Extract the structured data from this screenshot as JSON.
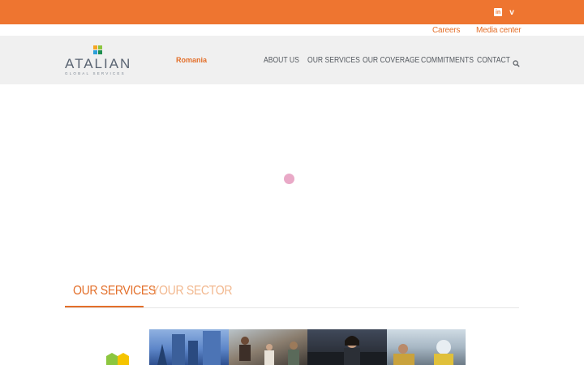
{
  "topbar": {
    "color": "#ee7530",
    "social": [
      {
        "icon": "linkedin-icon",
        "glyph": "in"
      },
      {
        "icon": "vimeo-icon",
        "glyph": "v"
      }
    ]
  },
  "utility_links": {
    "careers": "Careers",
    "media_center": "Media center"
  },
  "header": {
    "logo": {
      "name": "ATALIAN",
      "tagline": "GLOBAL SERVICES"
    },
    "country": "Romania",
    "nav": {
      "about": "ABOUT US",
      "services": "OUR SERVICES",
      "coverage": "OUR COVERAGE",
      "commitments": "COMMITMENTS",
      "contact": "CONTACT"
    },
    "search_icon": "search-icon"
  },
  "loader": {
    "color": "#e9a9c7"
  },
  "tabs": {
    "services": "OUR SERVICES",
    "sector": "YOUR SECTOR",
    "active": "services"
  },
  "accent_color": "#e36f2a"
}
